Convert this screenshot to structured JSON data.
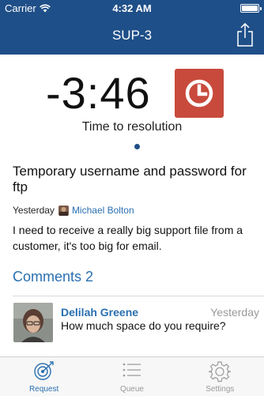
{
  "status_bar": {
    "carrier": "Carrier",
    "time": "4:32 AM"
  },
  "nav": {
    "title": "SUP-3",
    "share_icon": "share-icon"
  },
  "timer": {
    "value": "-3:46",
    "label": "Time to resolution",
    "badge_icon": "clock-icon",
    "badge_color": "#c84a3c"
  },
  "ticket": {
    "title": "Temporary username and password for ftp",
    "date": "Yesterday",
    "author": "Michael Bolton",
    "body": "I need to receive a really big support file from a customer, it's too big for email."
  },
  "comments": {
    "label": "Comments",
    "count": "2",
    "items": [
      {
        "author": "Delilah Greene",
        "time": "Yesterday",
        "text": "How much space do you require?"
      }
    ]
  },
  "tabs": [
    {
      "label": "Request",
      "icon": "target-icon",
      "active": true
    },
    {
      "label": "Queue",
      "icon": "list-icon",
      "active": false
    },
    {
      "label": "Settings",
      "icon": "gear-icon",
      "active": false
    }
  ],
  "colors": {
    "header": "#1f4f88",
    "accent": "#2a6fb0",
    "badge": "#c84a3c"
  }
}
